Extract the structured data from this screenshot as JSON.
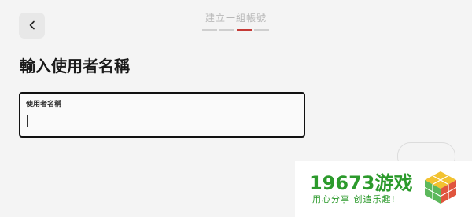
{
  "header": {
    "title": "建立一組帳號",
    "progress": {
      "steps": 4,
      "current": 3
    }
  },
  "page": {
    "title": "輸入使用者名稱"
  },
  "username_field": {
    "label": "使用者名稱",
    "value": ""
  },
  "colors": {
    "accent": "#c43a36",
    "background": "#f4f4f4",
    "watermark": "#2c9a2c"
  },
  "icons": {
    "back": "chevron-left-icon"
  },
  "watermark": {
    "logo": "19673游戏",
    "slogan": "用心分享 创造乐趣!"
  }
}
